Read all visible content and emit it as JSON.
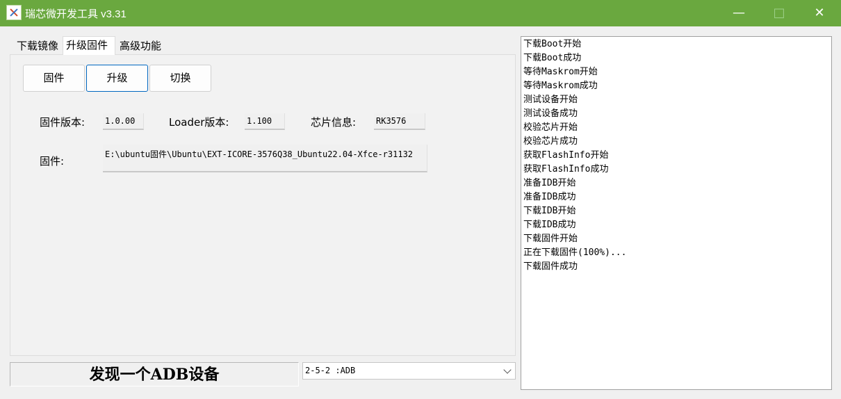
{
  "window": {
    "title": "瑞芯微开发工具 v3.31",
    "min_symbol": "—",
    "max_symbol": "□",
    "close_symbol": "✕",
    "titlebar_color": "#6aa83f"
  },
  "tabs": [
    {
      "label": "下载镜像"
    },
    {
      "label": "升级固件"
    },
    {
      "label": "高级功能"
    }
  ],
  "actions": {
    "firmware_label": "固件",
    "upgrade_label": "升级",
    "switch_label": "切换"
  },
  "info": {
    "fw_version_label": "固件版本:",
    "fw_version_value": "1.0.00",
    "loader_label": "Loader版本:",
    "loader_value": "1.100",
    "chip_label": "芯片信息:",
    "chip_value": "RK3576",
    "firmware_path_label": "固件:",
    "firmware_path_value": "E:\\ubuntu固件\\Ubuntu\\EXT-ICORE-3576Q38_Ubuntu22.04-Xfce-r31132"
  },
  "status": {
    "message": "发现一个ADB设备",
    "device_selected": "2-5-2 :ADB"
  },
  "log": [
    "下载Boot开始",
    "下载Boot成功",
    "等待Maskrom开始",
    "等待Maskrom成功",
    "测试设备开始",
    "测试设备成功",
    "校验芯片开始",
    "校验芯片成功",
    "获取FlashInfo开始",
    "获取FlashInfo成功",
    "准备IDB开始",
    "准备IDB成功",
    "下载IDB开始",
    "下载IDB成功",
    "下载固件开始",
    "正在下载固件(100%)...",
    "下载固件成功"
  ]
}
